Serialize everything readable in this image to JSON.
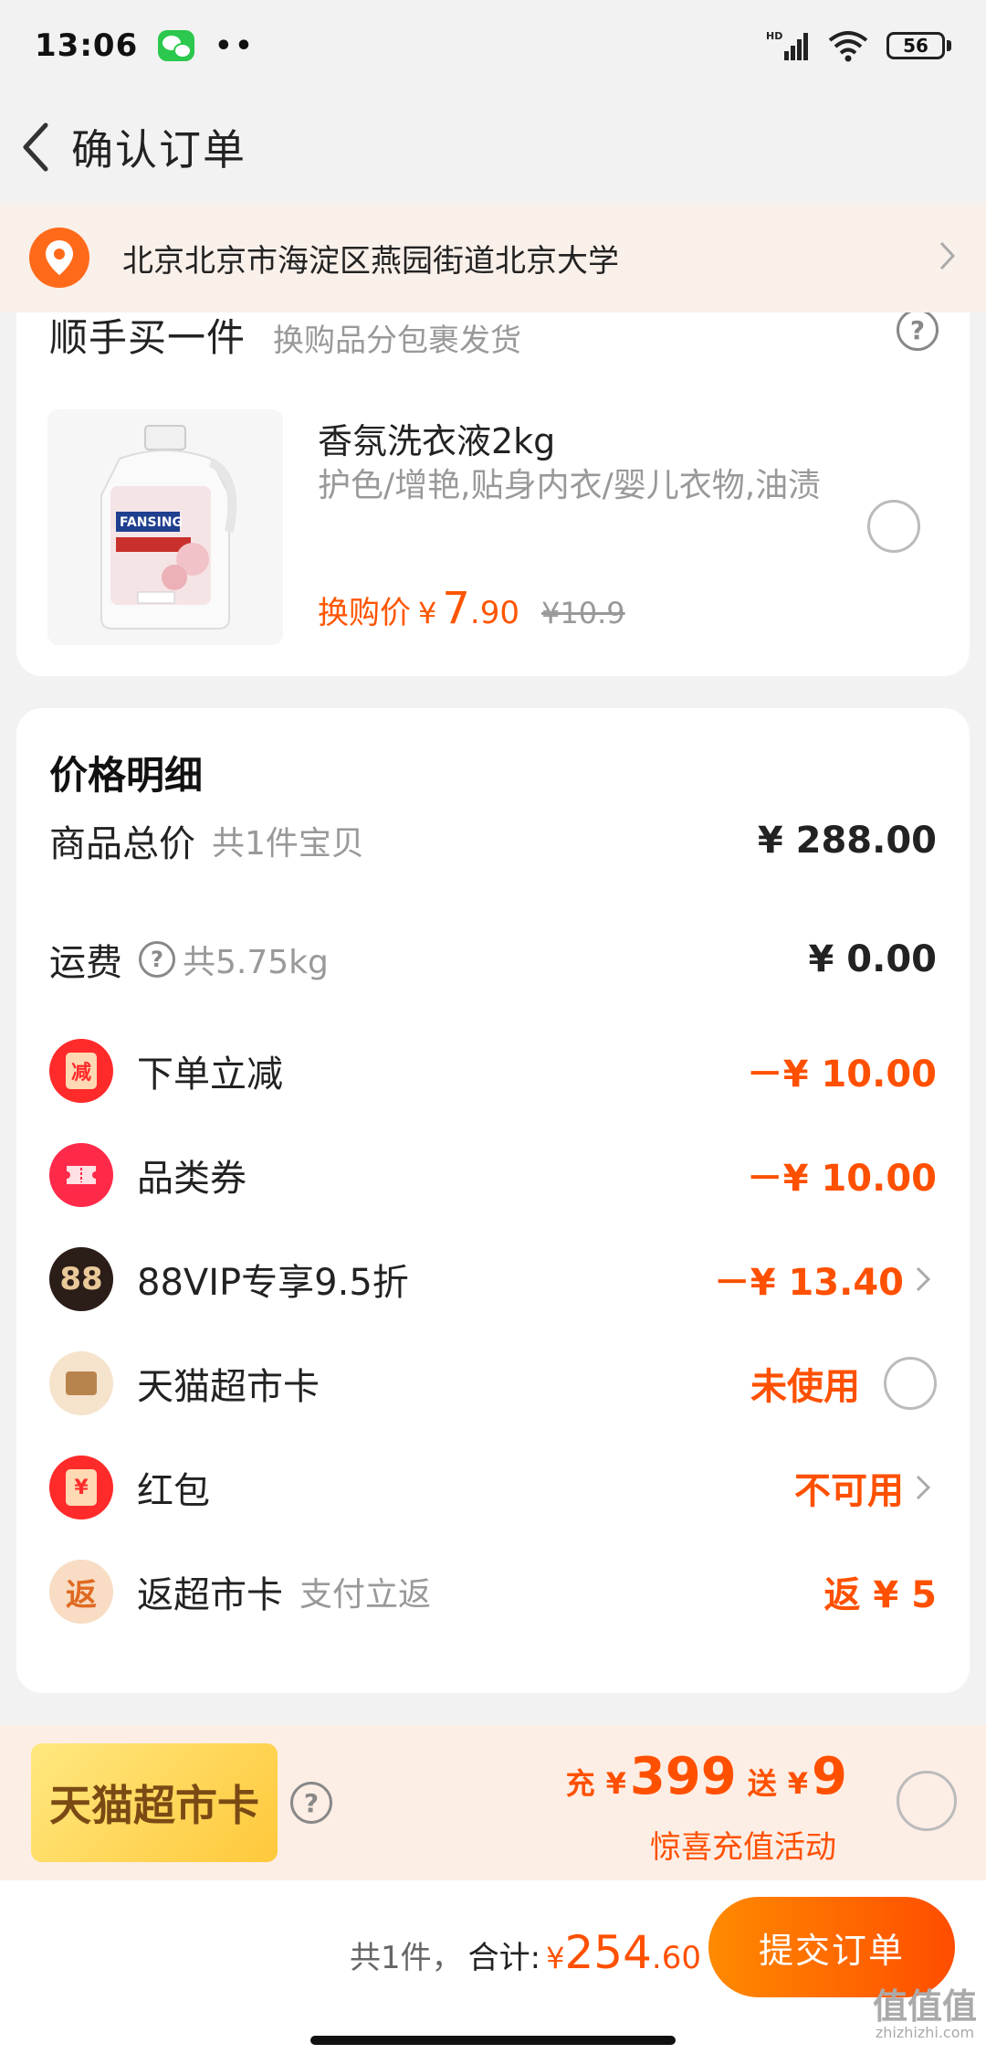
{
  "status_bar": {
    "time": "13:06",
    "dots": "••",
    "network": "HD",
    "battery": "56"
  },
  "header": {
    "title": "确认订单"
  },
  "address": {
    "text": "北京北京市海淀区燕园街道北京大学"
  },
  "addon": {
    "title": "顺手买一件",
    "subtitle": "换购品分包裹发货",
    "help": "?",
    "product": {
      "name": "香氛洗衣液2kg",
      "description": "护色/增艳,贴身内衣/婴儿衣物,油渍",
      "price_label": "换购价",
      "yen": "¥",
      "price_int": "7",
      "price_dec": ".90",
      "old_price": "¥10.9",
      "image_brand": "FANSING"
    }
  },
  "price_detail": {
    "title": "价格明细",
    "rows": [
      {
        "label": "商品总价",
        "sub": "共1件宝贝",
        "value": "¥ 288.00"
      },
      {
        "label": "运费",
        "sub": "共5.75kg",
        "value": "¥ 0.00"
      },
      {
        "label": "下单立减",
        "value": "－¥ 10.00",
        "icon_text": "减"
      },
      {
        "label": "品类券",
        "value": "－¥ 10.00"
      },
      {
        "label": "88VIP专享9.5折",
        "value": "－¥ 13.40",
        "icon_text": "88"
      },
      {
        "label": "天猫超市卡",
        "value": "未使用"
      },
      {
        "label": "红包",
        "value": "不可用",
        "icon_text": "¥"
      },
      {
        "label": "返超市卡",
        "sub": "支付立返",
        "value": "返 ¥ 5",
        "icon_text": "返"
      }
    ]
  },
  "promo": {
    "badge": "天猫超市卡",
    "help": "?",
    "charge_label": "充",
    "charge_yen": "¥",
    "charge_amount": "399",
    "gift_label": "送",
    "gift_yen": "¥",
    "gift_amount": "9",
    "description": "惊喜充值活动"
  },
  "bottom": {
    "count": "共1件，",
    "total_label": "合计:",
    "yen": "¥",
    "total_int": "254",
    "total_dec": ".60",
    "submit": "提交订单"
  },
  "watermark": {
    "main": "值值值",
    "sub": "zhizhizhi.com"
  },
  "colors": {
    "accent": "#ff5000",
    "button_start": "#ff8a00",
    "button_end": "#ff4d00",
    "address_bg": "#faf0ea",
    "promo_bg": "#fdeee5"
  }
}
